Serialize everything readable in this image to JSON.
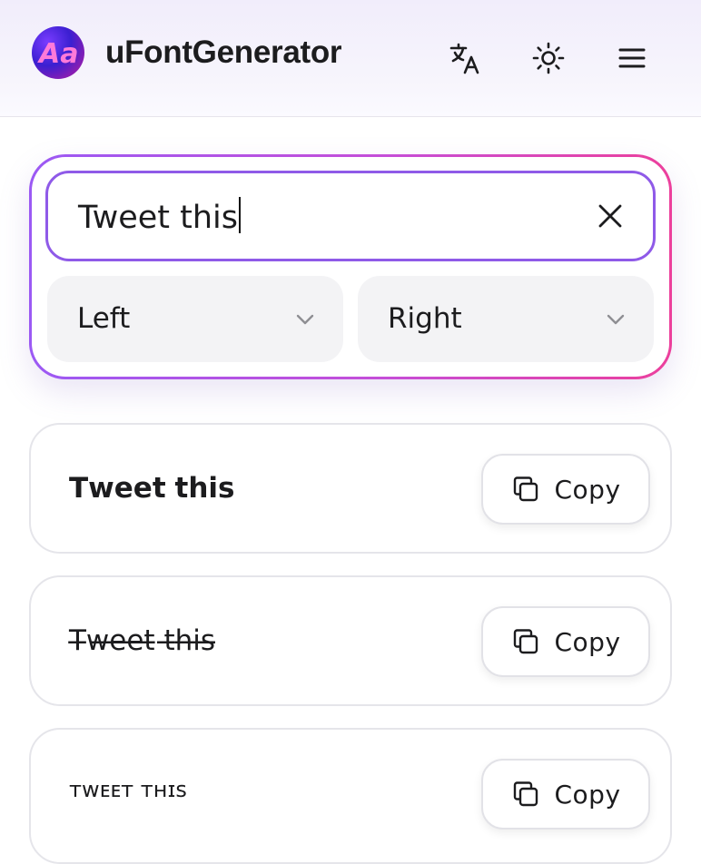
{
  "header": {
    "logo_text": "Aa",
    "title": "uFontGenerator",
    "icons": [
      "translate-icon",
      "sun-icon",
      "menu-icon"
    ]
  },
  "input": {
    "value": "Tweet this",
    "clear_icon": "close-icon",
    "border_colors": [
      "#9b59f4",
      "#ec3f9c"
    ]
  },
  "selects": {
    "left": {
      "value": "Left"
    },
    "right": {
      "value": "Right"
    }
  },
  "results": [
    {
      "text": "𝗧𝘄𝗲𝗲𝘁 𝘁𝗵𝗶𝘀",
      "copy_label": "Copy"
    },
    {
      "text": "T̶w̶e̶e̶t̶ t̶h̶i̶s̶",
      "copy_label": "Copy"
    },
    {
      "text": "ᴛᴡᴇᴇᴛ ᴛʜɪꜱ",
      "copy_label": "Copy"
    }
  ]
}
